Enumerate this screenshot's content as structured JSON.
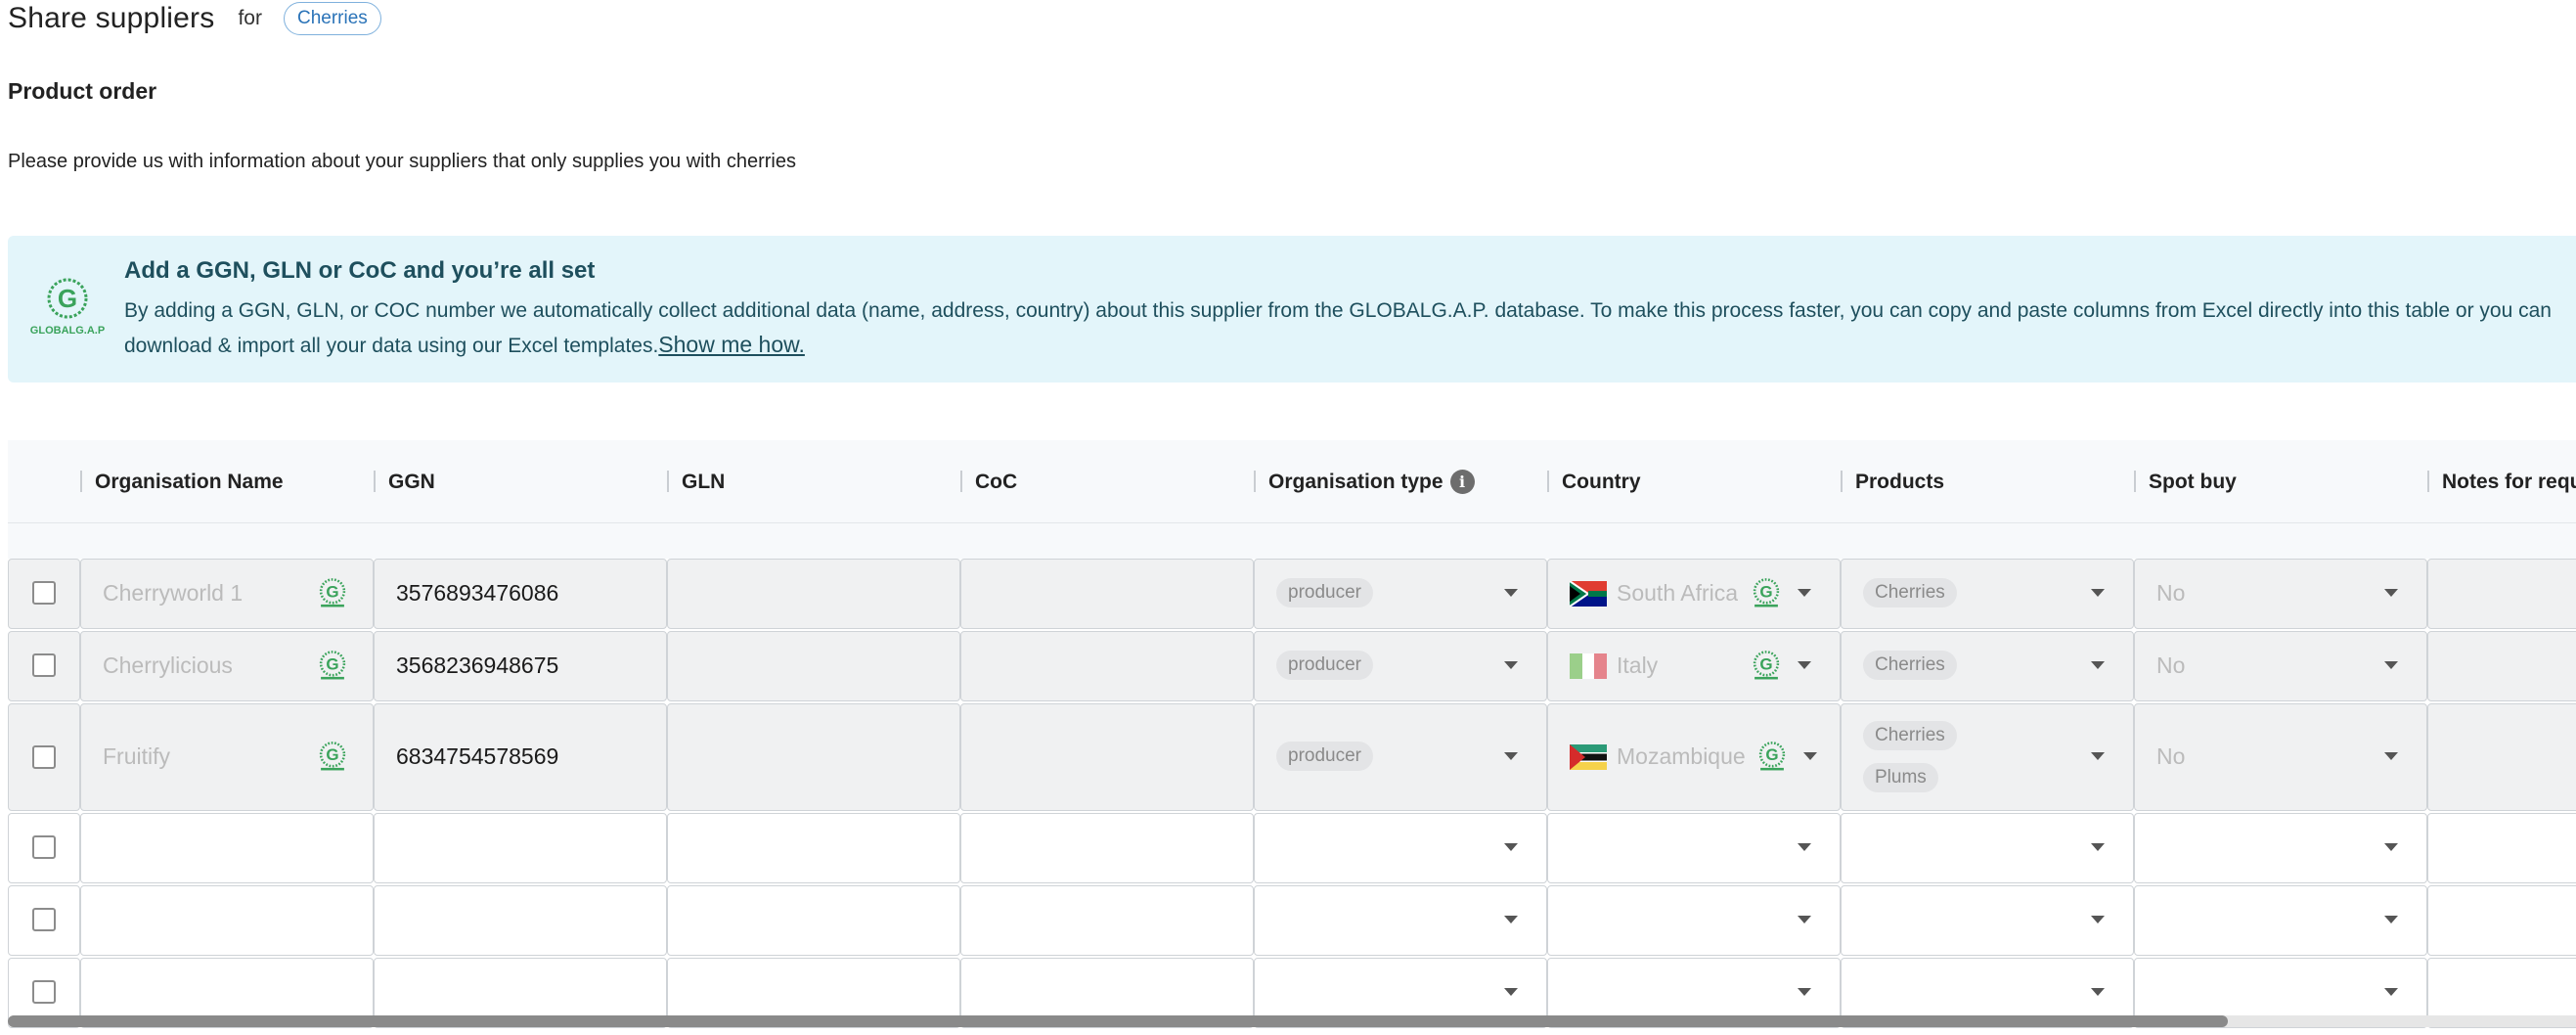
{
  "header": {
    "title": "Share suppliers",
    "for_text": "for",
    "product_chip": "Cherries"
  },
  "section": {
    "title": "Product order",
    "description": "Please provide us with information about your suppliers that only supplies you with cherries"
  },
  "banner": {
    "heading": "Add a GGN, GLN or CoC and you’re all set",
    "text": "By adding a GGN, GLN, or COC number we automatically collect additional data (name, address, country) about this supplier from the GLOBALG.A.P. database. To make this process faster, you can copy and paste columns from Excel directly into this table or you can download & import all your data using our Excel templates.",
    "link": "Show me how.",
    "logo_text": "GLOBALG.A.P"
  },
  "table": {
    "columns": [
      "Organisation Name",
      "GGN",
      "GLN",
      "CoC",
      "Organisation type",
      "Country",
      "Products",
      "Spot buy",
      "Notes for requ"
    ],
    "rows": [
      {
        "name": "Cherryworld 1",
        "ggn": "3576893476086",
        "gln": "",
        "coc": "",
        "org_type": "producer",
        "country": "South Africa",
        "country_flag": "south-africa-flag-icon",
        "products": [
          "Cherries"
        ],
        "spot_buy": "No",
        "notes": ""
      },
      {
        "name": "Cherrylicious",
        "ggn": "3568236948675",
        "gln": "",
        "coc": "",
        "org_type": "producer",
        "country": "Italy",
        "country_flag": "italy-flag-icon",
        "products": [
          "Cherries"
        ],
        "spot_buy": "No",
        "notes": ""
      },
      {
        "name": "Fruitify",
        "ggn": "6834754578569",
        "gln": "",
        "coc": "",
        "org_type": "producer",
        "country": "Mozambique",
        "country_flag": "mozambique-flag-icon",
        "products": [
          "Cherries",
          "Plums"
        ],
        "spot_buy": "No",
        "notes": ""
      }
    ],
    "empty_row_count": 3
  },
  "colors": {
    "accent": "#2a73b8",
    "banner_bg": "#e3f5fa",
    "banner_text": "#1e4f5d",
    "globalgap_green": "#3aa35b"
  },
  "scroll": {
    "horizontal_visible_fraction": 0.86
  }
}
